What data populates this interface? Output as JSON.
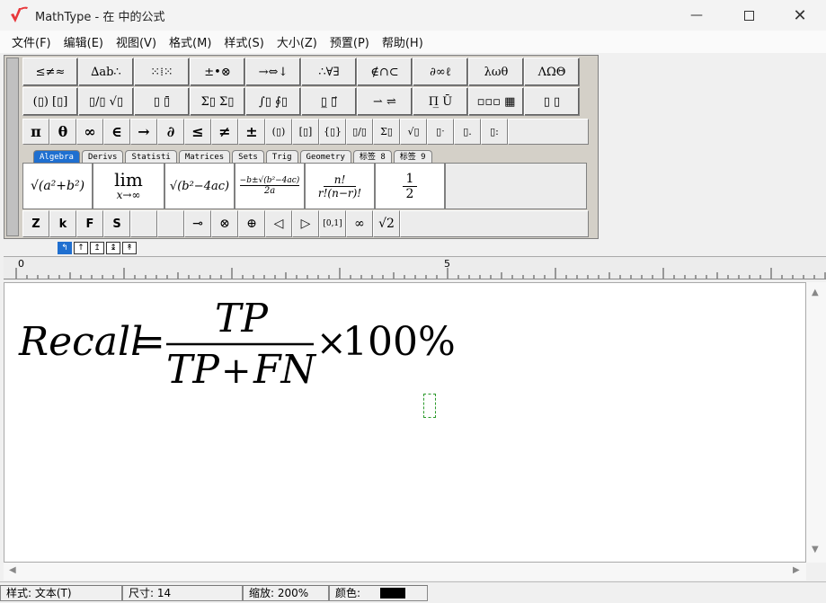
{
  "window": {
    "title": "MathType - 在  中的公式",
    "minimize_icon": "minimize-icon",
    "maximize_icon": "maximize-icon",
    "close_icon": "close-icon",
    "brand_color": "#e8373b"
  },
  "menu": [
    {
      "label": "文件(F)"
    },
    {
      "label": "编辑(E)"
    },
    {
      "label": "视图(V)"
    },
    {
      "label": "格式(M)"
    },
    {
      "label": "样式(S)"
    },
    {
      "label": "大小(Z)"
    },
    {
      "label": "预置(P)"
    },
    {
      "label": "帮助(H)"
    }
  ],
  "palette_row1": [
    {
      "label": "≤≠≈"
    },
    {
      "label": "∆ab∴"
    },
    {
      "label": "⁙⁞⁙"
    },
    {
      "label": "±•⊗"
    },
    {
      "label": "→⇔↓"
    },
    {
      "label": "∴∀∃"
    },
    {
      "label": "∉∩⊂"
    },
    {
      "label": "∂∞ℓ"
    },
    {
      "label": "λωθ"
    },
    {
      "label": "ΛΩΘ"
    }
  ],
  "palette_row2": [
    {
      "label": "(▯) [▯]"
    },
    {
      "label": "▯/▯ √▯"
    },
    {
      "label": "▯ ▯̄"
    },
    {
      "label": "Σ▯ Σ▯"
    },
    {
      "label": "∫▯ ∮▯"
    },
    {
      "label": "▯̲ ▯⃗"
    },
    {
      "label": "⇀ ⇌"
    },
    {
      "label": "Π̲ Ū"
    },
    {
      "label": "▫▫▫ ▦"
    },
    {
      "label": "▯ ▯"
    }
  ],
  "symbols": [
    {
      "label": "π",
      "small": false
    },
    {
      "label": "θ",
      "small": false
    },
    {
      "label": "∞",
      "small": false
    },
    {
      "label": "∈",
      "small": false
    },
    {
      "label": "→",
      "small": false
    },
    {
      "label": "∂",
      "small": false
    },
    {
      "label": "≤",
      "small": false
    },
    {
      "label": "≠",
      "small": false
    },
    {
      "label": "±",
      "small": false
    },
    {
      "label": "(▯)",
      "small": true
    },
    {
      "label": "[▯]",
      "small": true
    },
    {
      "label": "{▯}",
      "small": true
    },
    {
      "label": "▯/▯",
      "small": true
    },
    {
      "label": "Σ▯",
      "small": true
    },
    {
      "label": "√▯",
      "small": true
    },
    {
      "label": "▯ˑ",
      "small": true
    },
    {
      "label": "▯.",
      "small": true
    },
    {
      "label": "▯:",
      "small": true
    }
  ],
  "tabs": [
    {
      "label": "Algebra",
      "active": true
    },
    {
      "label": "Derivs",
      "active": false
    },
    {
      "label": "Statisti",
      "active": false
    },
    {
      "label": "Matrices",
      "active": false
    },
    {
      "label": "Sets",
      "active": false
    },
    {
      "label": "Trig",
      "active": false
    },
    {
      "label": "Geometry",
      "active": false
    },
    {
      "label": "标签 8",
      "active": false
    },
    {
      "label": "标签 9",
      "active": false
    }
  ],
  "templates": {
    "t1": "√(a²+b²)",
    "t2_top": "lim",
    "t2_bottom": "x→∞",
    "t3": "√(b²−4ac)",
    "t4_top": "−b±√(b²−4ac)",
    "t4_bottom": "2a",
    "t5_top": "n!",
    "t5_bottom": "r!(n−r)!",
    "t6_top": "1",
    "t6_bottom": "2"
  },
  "bottom_row": [
    {
      "label": "Z",
      "bold": true
    },
    {
      "label": "k",
      "bold": true
    },
    {
      "label": "F",
      "bold": true
    },
    {
      "label": "S",
      "bold": true
    },
    {
      "label": "",
      "bold": false
    },
    {
      "label": "",
      "bold": false
    },
    {
      "label": "⊸",
      "bold": false
    },
    {
      "label": "⊗",
      "bold": false
    },
    {
      "label": "⊕",
      "bold": false
    },
    {
      "label": "◁",
      "bold": false
    },
    {
      "label": "▷",
      "bold": false
    },
    {
      "label": "[0,1]",
      "bold": false
    },
    {
      "label": "∞",
      "bold": false
    },
    {
      "label": "√2",
      "bold": false
    }
  ],
  "nudge": [
    {
      "label": "↰",
      "active": true
    },
    {
      "label": "↑",
      "active": false
    },
    {
      "label": "↥",
      "active": false
    },
    {
      "label": "↨",
      "active": false
    },
    {
      "label": "↟",
      "active": false
    }
  ],
  "ruler": {
    "label_0": "0",
    "label_5": "5"
  },
  "equation": {
    "lhs": "Recall",
    "equals": "=",
    "numerator": "TP",
    "denominator_a": "TP",
    "plus": "+",
    "denominator_b": "FN",
    "times": "×",
    "value": "100%"
  },
  "status": {
    "style": "样式:  文本(T)",
    "size": "尺寸:  14",
    "zoom": "缩放:  200%",
    "color_label": "颜色:",
    "color_value": "#000000"
  }
}
